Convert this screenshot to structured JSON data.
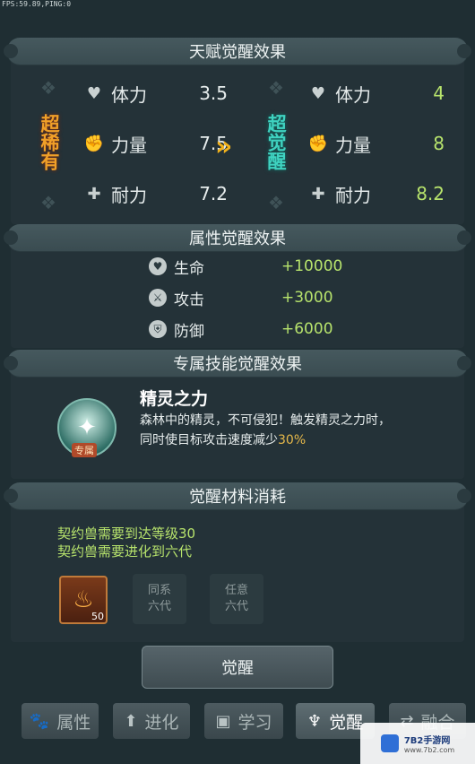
{
  "debug": {
    "fps": "FPS:59.89,PING:0"
  },
  "talent": {
    "title": "天赋觉醒效果",
    "from_rarity": "超稀有",
    "to_rarity": "超觉醒",
    "from_stats": [
      {
        "label": "体力",
        "value": "3.5",
        "icon": "heart-icon"
      },
      {
        "label": "力量",
        "value": "7.5",
        "icon": "fist-icon"
      },
      {
        "label": "耐力",
        "value": "7.2",
        "icon": "shield-cross-icon"
      }
    ],
    "to_stats": [
      {
        "label": "体力",
        "value": "4",
        "icon": "heart-icon"
      },
      {
        "label": "力量",
        "value": "8",
        "icon": "fist-icon"
      },
      {
        "label": "耐力",
        "value": "8.2",
        "icon": "shield-cross-icon"
      }
    ],
    "arrow": "»",
    "colors": {
      "from_rarity": "#f0a028",
      "to_rarity": "#3fd2c0",
      "to_value": "#b7e36c",
      "arrow": "#f2b21c"
    }
  },
  "attribute": {
    "title": "属性觉醒效果",
    "items": [
      {
        "label": "生命",
        "value": "+10000",
        "icon": "heart-icon"
      },
      {
        "label": "攻击",
        "value": "+3000",
        "icon": "sword-icon"
      },
      {
        "label": "防御",
        "value": "+6000",
        "icon": "shield-icon"
      }
    ]
  },
  "skill": {
    "title": "专属技能觉醒效果",
    "badge": "专属",
    "name": "精灵之力",
    "desc_line1": "森林中的精灵，不可侵犯！触发精灵之力时，",
    "desc_line2_prefix": "同时使目标攻击速度减少",
    "desc_line2_highlight": "30%"
  },
  "materials": {
    "title": "觉醒材料消耗",
    "req1": "契约兽需要到达等级30",
    "req2": "契约兽需要进化到六代",
    "item_count": "50",
    "slot1": [
      "同系",
      "六代"
    ],
    "slot2": [
      "任意",
      "六代"
    ]
  },
  "awaken_button": "觉醒",
  "tabs": [
    {
      "label": "属性",
      "icon": "paw-icon"
    },
    {
      "label": "进化",
      "icon": "up-arrow-icon"
    },
    {
      "label": "学习",
      "icon": "book-icon"
    },
    {
      "label": "觉醒",
      "icon": "horned-mask-icon"
    },
    {
      "label": "融合",
      "icon": "merge-icon"
    }
  ],
  "watermark": {
    "text": "7B2手游网",
    "domain": "www.7b2.com"
  }
}
